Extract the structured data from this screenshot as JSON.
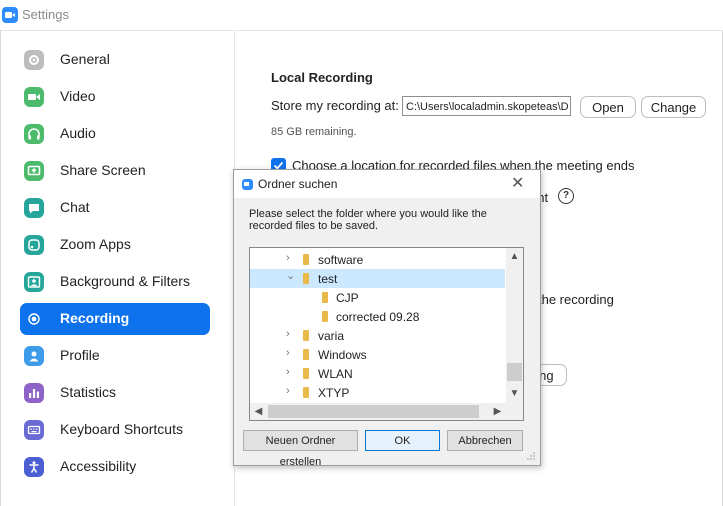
{
  "window": {
    "title": "Settings"
  },
  "sidebar": {
    "items": [
      {
        "label": "General",
        "icon": "gear-icon",
        "color": "#9e9e9e",
        "active": false
      },
      {
        "label": "Video",
        "icon": "video-camera-icon",
        "color": "#4cbb6c",
        "active": false
      },
      {
        "label": "Audio",
        "icon": "headphones-icon",
        "color": "#4cbb6c",
        "active": false
      },
      {
        "label": "Share Screen",
        "icon": "share-screen-icon",
        "color": "#4cbb6c",
        "active": false
      },
      {
        "label": "Chat",
        "icon": "chat-bubble-icon",
        "color": "#26a69a",
        "active": false
      },
      {
        "label": "Zoom Apps",
        "icon": "apps-icon",
        "color": "#26a69a",
        "active": false
      },
      {
        "label": "Background & Filters",
        "icon": "person-background-icon",
        "color": "#26a69a",
        "active": false
      },
      {
        "label": "Recording",
        "icon": "record-icon",
        "color": "#0E72ED",
        "active": true
      },
      {
        "label": "Profile",
        "icon": "profile-icon",
        "color": "#3d9be9",
        "active": false
      },
      {
        "label": "Statistics",
        "icon": "bar-chart-icon",
        "color": "#8e63c7",
        "active": false
      },
      {
        "label": "Keyboard Shortcuts",
        "icon": "keyboard-icon",
        "color": "#6a6ad5",
        "active": false
      },
      {
        "label": "Accessibility",
        "icon": "accessibility-icon",
        "color": "#4b5fd3",
        "active": false
      }
    ]
  },
  "main": {
    "section_title": "Local Recording",
    "store_label": "Store my recording at:",
    "store_path": "C:\\Users\\localadmin.skopeteas\\D",
    "open_label": "Open",
    "change_label": "Change",
    "remaining": "85 GB remaining.",
    "choose_location_label": "Choose a location for recorded files when the meeting ends",
    "choose_location_checked": true,
    "partial_ant": "ant",
    "partial_the_recording": "the recording",
    "partial_ding": "ding"
  },
  "dialog": {
    "title": "Ordner suchen",
    "instruction": "Please select the folder where you would like the recorded files to be saved.",
    "tree": [
      {
        "label": "software",
        "arrow": "›",
        "level": 1
      },
      {
        "label": "test",
        "arrow": "⌄",
        "level": 1,
        "selected": true
      },
      {
        "label": "CJP",
        "arrow": "",
        "level": 2
      },
      {
        "label": "corrected 09.28",
        "arrow": "",
        "level": 2
      },
      {
        "label": "varia",
        "arrow": "›",
        "level": 1
      },
      {
        "label": "Windows",
        "arrow": "›",
        "level": 1
      },
      {
        "label": "WLAN",
        "arrow": "›",
        "level": 1
      },
      {
        "label": "XTYP",
        "arrow": "›",
        "level": 1
      }
    ],
    "new_folder_label": "Neuen Ordner erstellen",
    "ok_label": "OK",
    "cancel_label": "Abbrechen"
  }
}
